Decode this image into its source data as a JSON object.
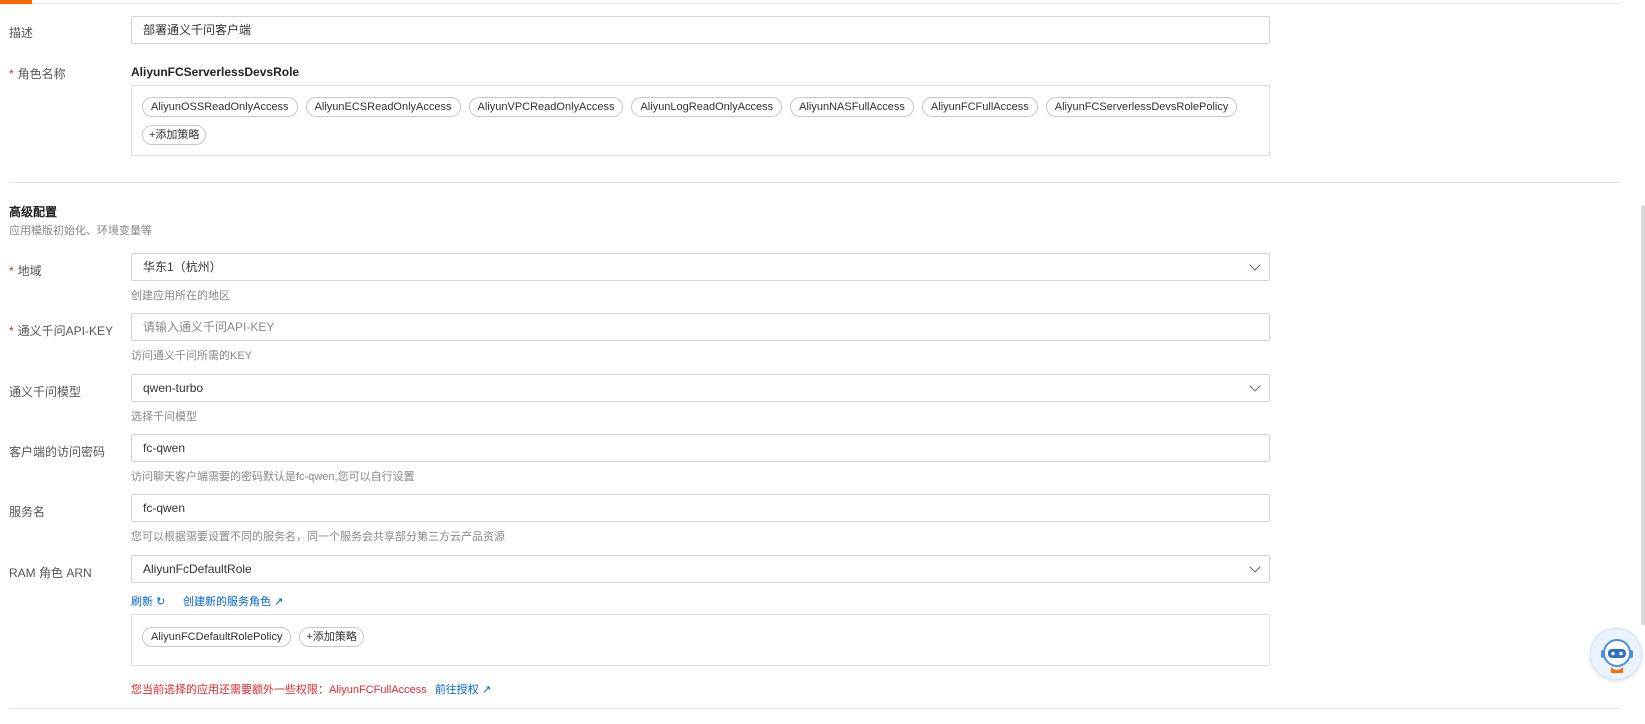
{
  "fields": {
    "desc": {
      "label": "描述",
      "value": "部署通义千问客户端"
    },
    "role": {
      "label": "角色名称",
      "name": "AliyunFCServerlessDevsRole",
      "policies": [
        "AliyunOSSReadOnlyAccess",
        "AliyunECSReadOnlyAccess",
        "AliyunVPCReadOnlyAccess",
        "AliyunLogReadOnlyAccess",
        "AliyunNASFullAccess",
        "AliyunFCFullAccess",
        "AliyunFCServerlessDevsRolePolicy"
      ],
      "add_policy": "+添加策略"
    }
  },
  "advanced": {
    "title": "高级配置",
    "desc": "应用模版初始化、环境变量等",
    "region": {
      "label": "地域",
      "value": "华东1（杭州）",
      "hint": "创建应用所在的地区"
    },
    "apikey": {
      "label": "通义千问API-KEY",
      "placeholder": "请输入通义千问API-KEY",
      "hint": "访问通义千问所需的KEY"
    },
    "model": {
      "label": "通义千问模型",
      "value": "qwen-turbo",
      "hint": "选择千问模型"
    },
    "password": {
      "label": "客户端的访问密码",
      "value": "fc-qwen",
      "hint": "访问聊天客户端需要的密码默认是fc-qwen,您可以自行设置"
    },
    "service": {
      "label": "服务名",
      "value": "fc-qwen",
      "hint": "您可以根据需要设置不同的服务名，同一个服务会共享部分第三方云产品资源"
    },
    "ram": {
      "label": "RAM 角色 ARN",
      "value": "AliyunFcDefaultRole",
      "refresh": "刷新",
      "create": "创建新的服务角色",
      "policies": [
        "AliyunFCDefaultRolePolicy"
      ],
      "add_policy": "+添加策略"
    },
    "warning": {
      "text": "您当前选择的应用还需要额外一些权限：AliyunFCFullAccess",
      "link": "前往授权"
    }
  },
  "colors": {
    "accent": "#ff6a00",
    "link": "#0064c8",
    "error": "#e0282e"
  }
}
